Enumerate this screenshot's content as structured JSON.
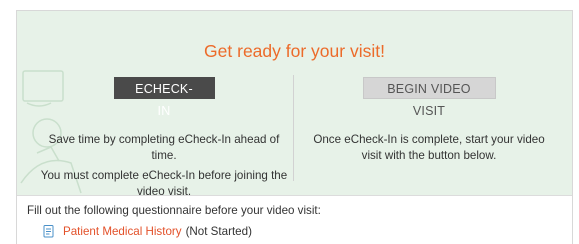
{
  "banner": {
    "headline": "Get ready for your visit!"
  },
  "echeckin": {
    "button_label": "ECHECK-IN",
    "description": "Save time by completing eCheck-In ahead of time.",
    "note": "You must complete eCheck-In before joining the video visit."
  },
  "video": {
    "button_label": "BEGIN VIDEO VISIT",
    "description": "Once eCheck-In is complete, start your video visit with the button below."
  },
  "questionnaire": {
    "intro": "Fill out the following questionnaire before your video visit:",
    "items": [
      {
        "label": "Patient Medical History",
        "status": "(Not Started)",
        "icon": "document-icon"
      }
    ]
  },
  "colors": {
    "accent": "#ec6b2a",
    "link": "#e3512a",
    "banner_bg": "#e7f2e8",
    "dark_button": "#4a4a4a",
    "disabled_button": "#d6d6d6"
  }
}
